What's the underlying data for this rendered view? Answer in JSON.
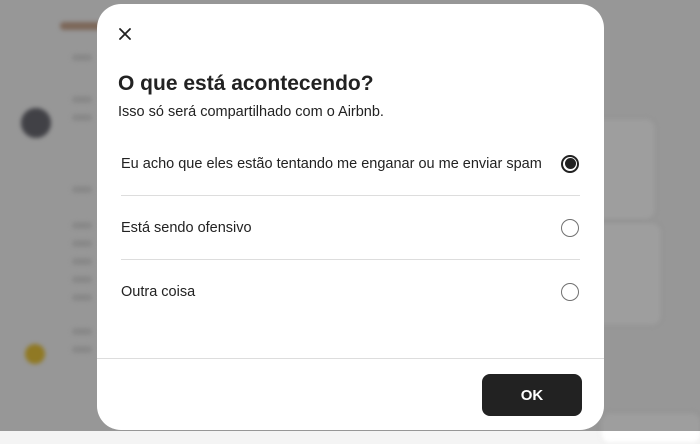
{
  "dialog": {
    "title": "O que está acontecendo?",
    "subtitle": "Isso só será compartilhado com o Airbnb.",
    "close_icon": "close-icon",
    "options": [
      {
        "label": "Eu acho que eles estão tentando me enganar ou me enviar spam",
        "selected": true
      },
      {
        "label": "Está sendo ofensivo",
        "selected": false
      },
      {
        "label": "Outra coisa",
        "selected": false
      }
    ],
    "ok_label": "OK"
  },
  "colors": {
    "text": "#222222",
    "button_bg": "#222222",
    "button_text": "#ffffff",
    "divider": "#dddddd",
    "overlay": "rgba(0,0,0,0.38)"
  }
}
